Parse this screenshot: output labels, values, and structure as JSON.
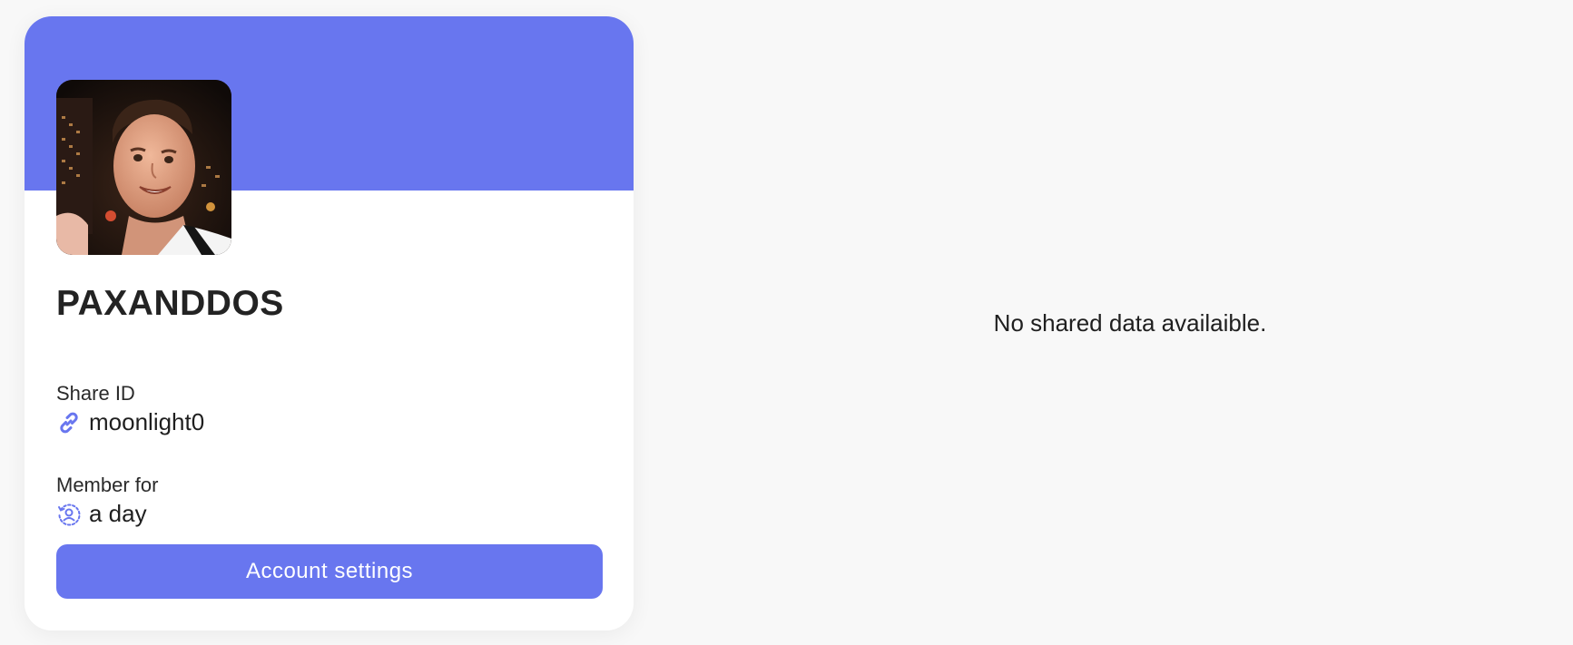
{
  "profile": {
    "username": "PAXANDDOS",
    "avatar_alt": "User avatar",
    "share_id": {
      "label": "Share ID",
      "value": "moonlight0",
      "icon": "link-icon"
    },
    "member_for": {
      "label": "Member for",
      "value": "a day",
      "icon": "user-clock-icon"
    },
    "settings_button_label": "Account settings"
  },
  "main": {
    "empty_message": "No shared data availaible."
  },
  "colors": {
    "accent": "#6876ef",
    "background": "#f8f8f8",
    "card": "#ffffff",
    "text": "#1f1f1f"
  }
}
